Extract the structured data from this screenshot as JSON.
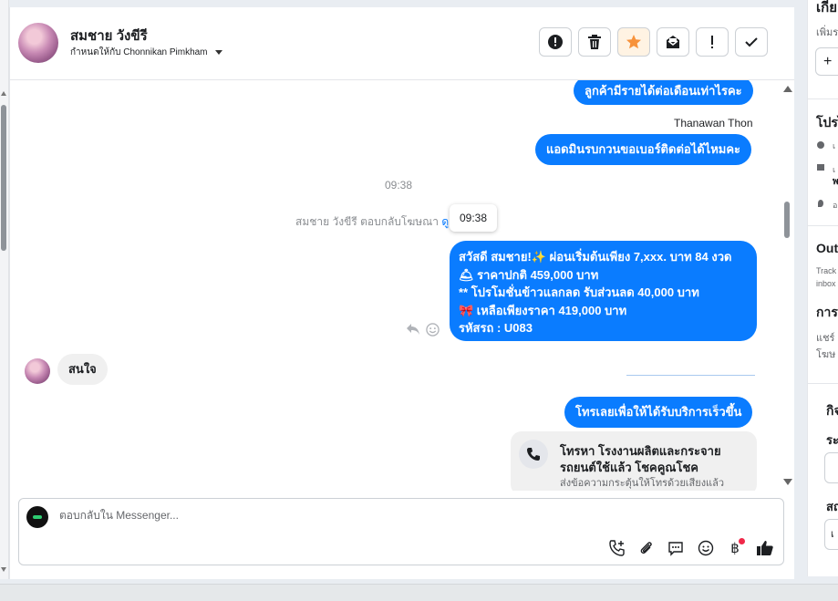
{
  "contact": {
    "name": "สมชาย วังขีรี",
    "assign_prefix": "กำหนดให้กับ",
    "assignee": "Chonnikan Pimkham"
  },
  "header_actions": [
    {
      "name": "spam-button",
      "icon": "exclamation-circle-icon"
    },
    {
      "name": "delete-button",
      "icon": "trash-icon"
    },
    {
      "name": "star-button",
      "icon": "star-icon",
      "color": "#f7923b"
    },
    {
      "name": "unread-button",
      "icon": "envelope-icon"
    },
    {
      "name": "follow-up-button",
      "icon": "exclamation-icon"
    },
    {
      "name": "done-button",
      "icon": "check-icon"
    }
  ],
  "messages": {
    "top_partial": "ลูกค้ามีรายได้ต่อเดือนเท่าไรคะ",
    "sender_name": "Thanawan Thon",
    "ask_phone": "แอดมินรบกวนขอเบอร์ติดต่อได้ไหมคะ",
    "time": "09:38",
    "ad_reply_text": "สมชาย วังขีรี ตอบกลับโฆษณา",
    "ad_reply_link": "ดู",
    "tooltip_time": "09:38",
    "promo_lines": [
      "สวัสดี สมชาย!✨  ผ่อนเริ่มต้นเพียง 7,xxx. บาท 84 งวด",
      "🛎 ราคาปกติ 459,000 บาท",
      "** โปรโมชั่นข้าวแลกลด รับส่วนลด 40,000 บาท",
      "🎀  เหลือเพียงราคา 419,000 บาท",
      " รหัสรถ : U083"
    ],
    "customer_reply": "สนใจ",
    "call_prompt": "โทรเลยเพื่อให้ได้รับบริการเร็วขึ้น",
    "call_card_title_1": "โทรหา โรงงานผลิตและกระจาย",
    "call_card_title_2": "รถยนต์ใช้แล้ว โชคคูณโชค",
    "call_card_sub": "ส่งข้อความกระตุ้นให้โทรด้วยเสียงแล้ว"
  },
  "composer": {
    "placeholder": "ตอบกลับใน Messenger...",
    "icons": [
      "add-call-icon",
      "paperclip-icon",
      "saved-reply-icon",
      "emoji-icon",
      "baht-icon",
      "thumbs-up-icon"
    ],
    "notification_dot_color": "#f02849"
  },
  "right_panel": {
    "r1": "เกี่ย",
    "r2": "เพิ่มร",
    "r3": "+",
    "r4": "โปรไ",
    "r5": "เ",
    "r6": "เ",
    "r7": "พ",
    "r8": "อ",
    "r9": "Outc",
    "r10": "Track",
    "r11": "inbox",
    "r12": "การ",
    "r13": "แชร์",
    "r14": "โฆษ",
    "r15": "กิจ",
    "r16": "ระ",
    "r17": "สถ",
    "r18": "เ"
  },
  "colors": {
    "accent": "#0a7cff",
    "star": "#f7923b"
  }
}
